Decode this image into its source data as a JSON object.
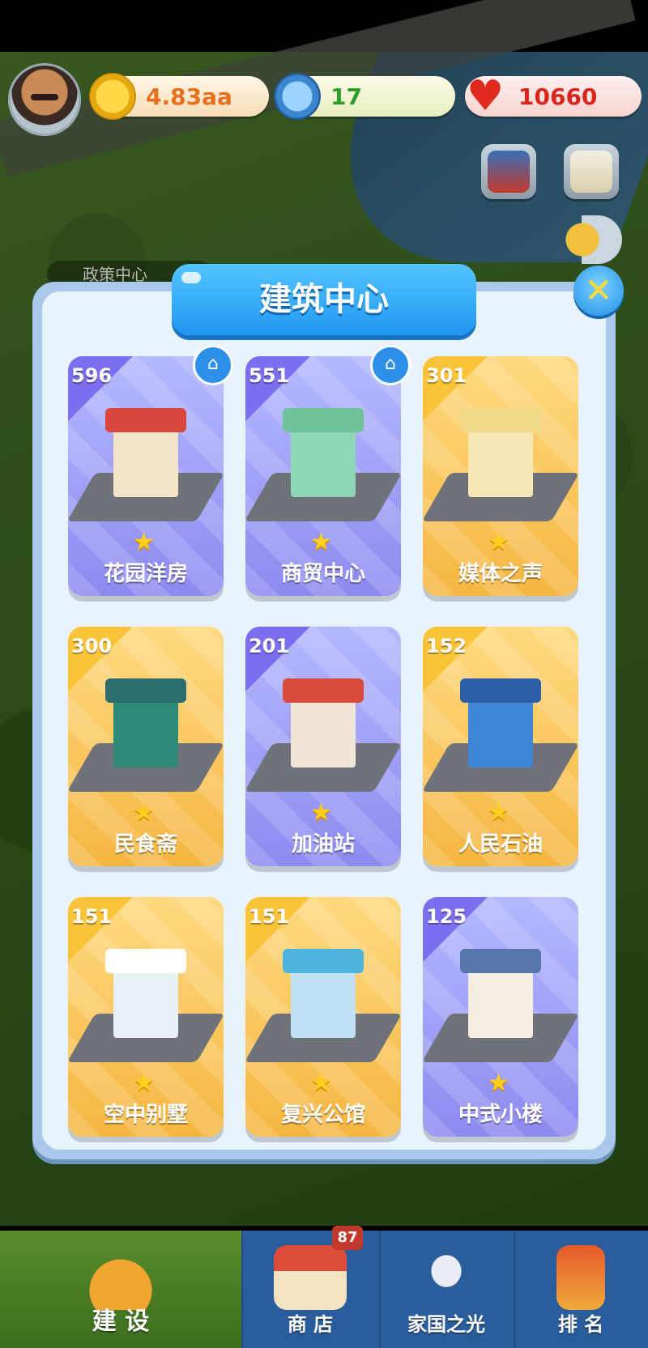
{
  "status": {
    "coins": "4.83aa",
    "stars": "17",
    "hearts": "10660"
  },
  "modal": {
    "title": "建筑中心",
    "buildings": [
      {
        "count": "596",
        "name": "花园洋房",
        "theme": "purple",
        "home": true
      },
      {
        "count": "551",
        "name": "商贸中心",
        "theme": "purple",
        "home": true
      },
      {
        "count": "301",
        "name": "媒体之声",
        "theme": "gold",
        "home": false
      },
      {
        "count": "300",
        "name": "民食斋",
        "theme": "gold",
        "home": false
      },
      {
        "count": "201",
        "name": "加油站",
        "theme": "purple",
        "home": false
      },
      {
        "count": "152",
        "name": "人民石油",
        "theme": "gold",
        "home": false
      },
      {
        "count": "151",
        "name": "空中别墅",
        "theme": "gold",
        "home": false
      },
      {
        "count": "151",
        "name": "复兴公馆",
        "theme": "gold",
        "home": false
      },
      {
        "count": "125",
        "name": "中式小楼",
        "theme": "purple",
        "home": false
      }
    ]
  },
  "background_label": "政策中心",
  "nav": {
    "items": [
      {
        "label": "建 设",
        "icon": "hardhat-icon",
        "active": true
      },
      {
        "label": "商 店",
        "icon": "shop-icon",
        "active": false
      },
      {
        "label": "家国之光",
        "icon": "rocket-icon",
        "active": false
      },
      {
        "label": "排 名",
        "icon": "podium-icon",
        "active": false
      }
    ],
    "shop_badge": "87"
  },
  "colors": {
    "panel": "#e9f3fd",
    "title_tab": "#1f97f0",
    "card_purple": "#8d8af0",
    "card_gold": "#f5b640"
  }
}
